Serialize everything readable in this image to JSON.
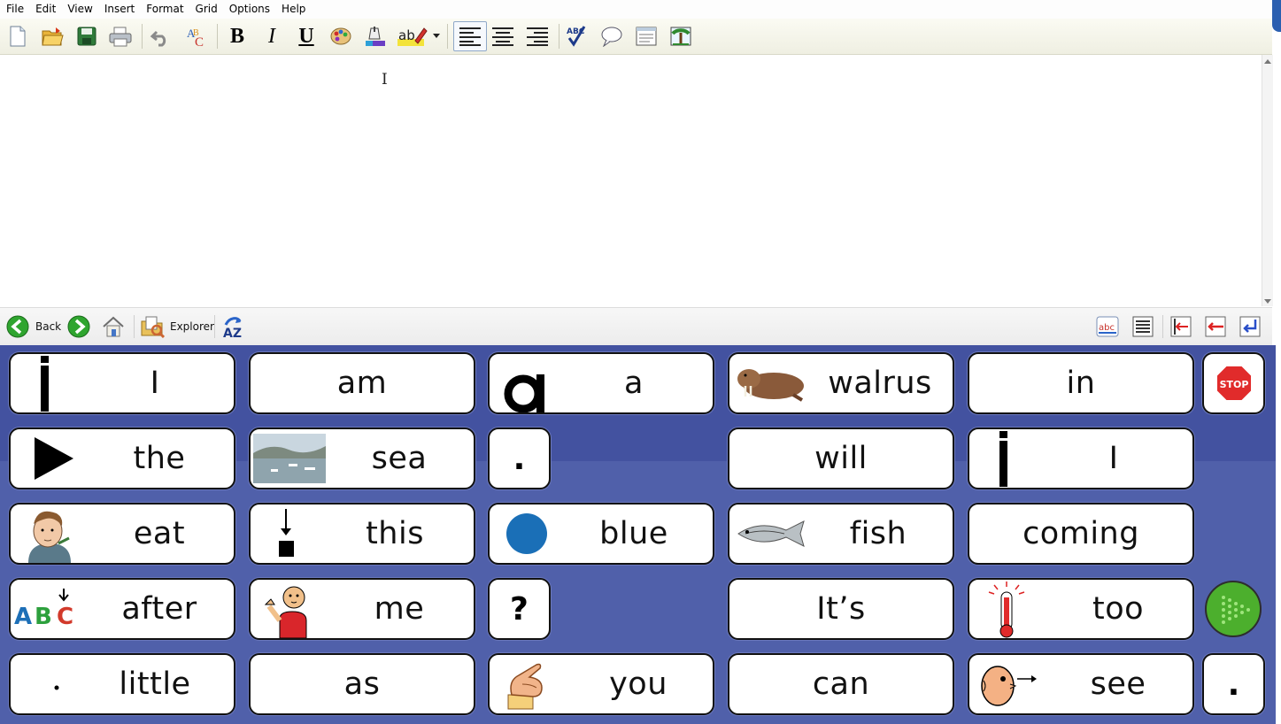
{
  "menu": [
    "File",
    "Edit",
    "View",
    "Insert",
    "Format",
    "Grid",
    "Options",
    "Help"
  ],
  "toolbar": {
    "bold": "B",
    "italic": "I",
    "underline": "U",
    "spell": "ABC",
    "new_icon": "new-document-icon",
    "open_icon": "open-folder-icon",
    "save_icon": "save-disk-icon",
    "print_icon": "printer-icon",
    "undo_icon": "undo-icon",
    "font_icon": "font-style-icon",
    "color_icon": "palette-icon",
    "background_icon": "paint-bucket-icon",
    "highlight_icon": "highlighter-icon"
  },
  "navbar": {
    "back": "Back",
    "explorer": "Explorer"
  },
  "grid": {
    "colors": {
      "background": "#5060aa",
      "band": "#4352a0",
      "cell": "#ffffff",
      "border": "#111111"
    },
    "cells": {
      "i1": "I",
      "am": "am",
      "a": "a",
      "walrus": "walrus",
      "in": "in",
      "the": "the",
      "sea": "sea",
      "period1": ".",
      "will": "will",
      "i2": "I",
      "eat": "eat",
      "this": "this",
      "blue": "blue",
      "fish": "fish",
      "coming": "coming",
      "after": "after",
      "me": "me",
      "question": "?",
      "its": "It’s",
      "too": "too",
      "little": "little",
      "as": "as",
      "you": "you",
      "can": "can",
      "see": "see",
      "period2": "."
    },
    "stop_label": "STOP",
    "abc_symbol": {
      "a": "A",
      "b": "B",
      "c": "C"
    }
  }
}
